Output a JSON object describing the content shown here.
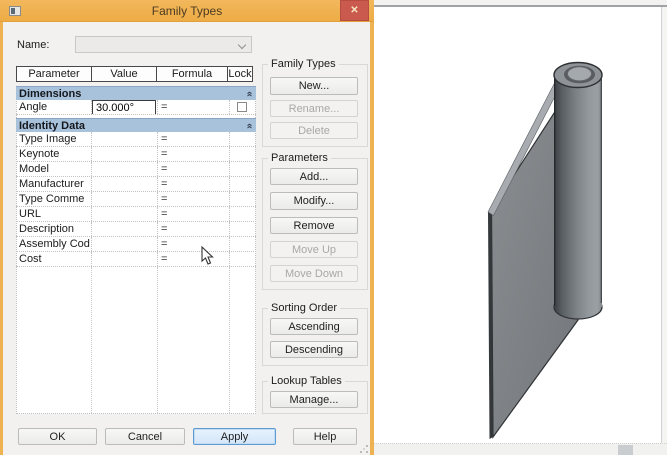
{
  "window": {
    "title": "Family Types"
  },
  "dialog": {
    "name_label": "Name:",
    "name_value": ""
  },
  "icons": {
    "close": "✕",
    "collapse": "«"
  },
  "table": {
    "headers": [
      "Parameter",
      "Value",
      "Formula",
      "Lock"
    ],
    "groups": [
      {
        "label": "Dimensions"
      },
      {
        "label": "Identity Data"
      }
    ],
    "angle_row": {
      "param": "Angle",
      "value": "30.000°",
      "formula": "=",
      "lock_checked": false
    },
    "identity_rows": [
      {
        "param": "Type Image",
        "formula": "="
      },
      {
        "param": "Keynote",
        "formula": "="
      },
      {
        "param": "Model",
        "formula": "="
      },
      {
        "param": "Manufacturer",
        "formula": "="
      },
      {
        "param": "Type Comme",
        "formula": "="
      },
      {
        "param": "URL",
        "formula": "="
      },
      {
        "param": "Description",
        "formula": "="
      },
      {
        "param": "Assembly Cod",
        "formula": "="
      },
      {
        "param": "Cost",
        "formula": "="
      }
    ]
  },
  "side_groups": [
    {
      "title": "Family Types",
      "buttons": [
        {
          "label": "New...",
          "enabled": true
        },
        {
          "label": "Rename...",
          "enabled": false
        },
        {
          "label": "Delete",
          "enabled": false
        }
      ]
    },
    {
      "title": "Parameters",
      "buttons": [
        {
          "label": "Add...",
          "enabled": true
        },
        {
          "label": "Modify...",
          "enabled": true
        },
        {
          "label": "Remove",
          "enabled": true
        },
        {
          "label": "Move Up",
          "enabled": false
        },
        {
          "label": "Move Down",
          "enabled": false
        }
      ]
    },
    {
      "title": "Sorting Order",
      "buttons": [
        {
          "label": "Ascending",
          "enabled": true
        },
        {
          "label": "Descending",
          "enabled": true
        }
      ]
    },
    {
      "title": "Lookup Tables",
      "buttons": [
        {
          "label": "Manage...",
          "enabled": true
        }
      ]
    }
  ],
  "footer": {
    "ok": "OK",
    "cancel": "Cancel",
    "apply": "Apply",
    "help": "Help"
  },
  "colors": {
    "titlebar": "#efb253",
    "close_button": "#cb5a4e",
    "category_header": "#a9c2dc",
    "apply_border": "#5e9bd3",
    "apply_bg": "#d9eafb"
  }
}
